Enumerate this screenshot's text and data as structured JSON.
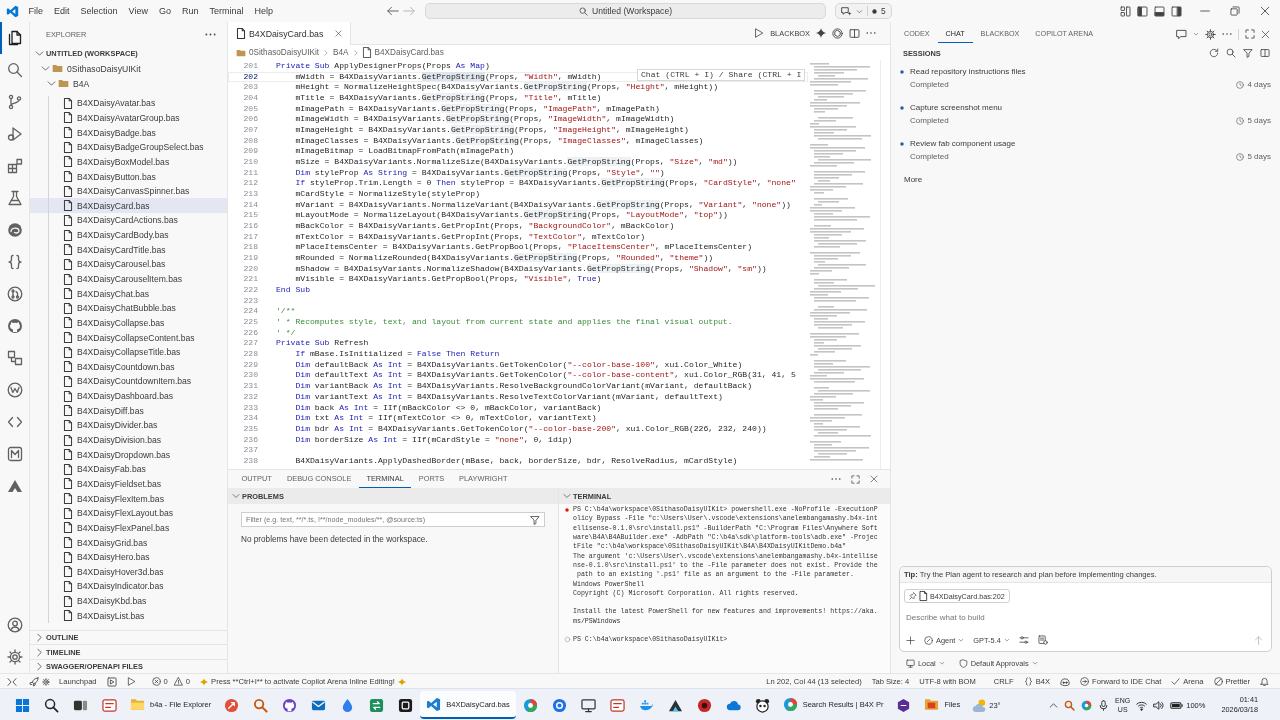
{
  "title_bar": {
    "menu": [
      "File",
      "Edit",
      "Selection",
      "View",
      "Go",
      "Run",
      "Terminal",
      "Help"
    ],
    "command_center": "Untitled (Workspace)",
    "badge": "5"
  },
  "activity_bar": [
    {
      "kind": "files",
      "selected": true
    },
    {
      "kind": "search",
      "selected": false
    },
    {
      "kind": "branch",
      "selected": false
    },
    {
      "kind": "debug",
      "selected": false
    },
    {
      "kind": "blocks",
      "selected": false
    },
    {
      "kind": "flask",
      "selected": false
    },
    {
      "kind": "browser",
      "selected": false
    },
    {
      "kind": "braces",
      "selected": false
    },
    {
      "kind": "pullrequest",
      "selected": false
    },
    {
      "kind": "cat",
      "selected": false
    },
    {
      "kind": "remote",
      "selected": false
    },
    {
      "kind": "wcircle",
      "selected": false
    },
    {
      "kind": "code",
      "selected": false
    },
    {
      "kind": "msquare",
      "selected": false
    },
    {
      "kind": "peak",
      "selected": false
    }
  ],
  "sidebar": {
    "title": "EXPLORER",
    "workspace": {
      "label": "UNTITLED (WORKSPACE)",
      "expanded": true
    },
    "tree": [
      {
        "label": "0SithasoDaisyUIKit",
        "expanded": true,
        "children": [
          {
            "label": "B4A",
            "expanded": true,
            "children": [
              {
                "label": "B4XDaisyAvatar.bas",
                "selected": false
              },
              {
                "label": "B4XDaisyAvatarGroup.bas",
                "selected": false
              },
              {
                "label": "B4XDaisyBadge.bas",
                "selected": false
              },
              {
                "label": "B4XDaisyBadgeGroupSelect.bas",
                "selected": false
              },
              {
                "label": "B4XDaisyBoxModel.bas",
                "selected": false
              },
              {
                "label": "B4XDaisyButton.bas",
                "selected": false
              },
              {
                "label": "B4XDaisyCanvasSpinner.bas",
                "selected": false
              },
              {
                "label": "B4XDaisyCard.bas",
                "selected": true
              },
              {
                "label": "B4XDaisyCardActions.bas",
                "selected": false
              },
              {
                "label": "B4XDaisyCardBody.bas",
                "selected": false
              },
              {
                "label": "B4XDaisyCardTitle.bas",
                "selected": false
              },
              {
                "label": "B4XDaisyCarousel.bas",
                "selected": false
              },
              {
                "label": "B4XDaisyCarouselItem.bas",
                "selected": false
              },
              {
                "label": "B4XDaisyChat.bas",
                "selected": false
              },
              {
                "label": "B4XDaisyChatBubble.bas",
                "selected": false
              },
              {
                "label": "B4XDaisyCollapse.bas",
                "selected": false
              },
              {
                "label": "B4XDaisyCollapseContent.bas",
                "selected": false
              },
              {
                "label": "B4XDaisyCollapseTitle.bas",
                "selected": false
              },
              {
                "label": "B4XDaisyCountdown.bas",
                "selected": false
              },
              {
                "label": "B4XDaisyCountdownItem.bas",
                "selected": false
              },
              {
                "label": "B4XDaisyDashboard.bas",
                "selected": false
              },
              {
                "label": "B4XDaisyDiff.bas",
                "selected": false
              },
              {
                "label": "B4XDaisyDivider.bas",
                "selected": false
              },
              {
                "label": "B4XDaisyDivision.bas",
                "selected": false
              },
              {
                "label": "B4XDaisyDropdown.bas",
                "selected": false
              },
              {
                "label": "B4XDaisyFab.bas",
                "selected": false
              },
              {
                "label": "B4XDaisyFieldset.bas",
                "selected": false
              },
              {
                "label": "B4XDaisyFlexItem.bas",
                "selected": false
              },
              {
                "label": "B4XDaisyFlexLayout.bas",
                "selected": false
              },
              {
                "label": "B4XDaisyFlexPanel.bas",
                "selected": false
              },
              {
                "label": "B4XDaisyGrid.bas",
                "selected": false
              },
              {
                "label": "B4XDaisyHero.bas",
                "selected": false
              },
              {
                "label": "B4XDaisyHover3d.bas",
                "selected": false
              },
              {
                "label": "B4XDaisyIndicator.bas",
                "selected": false
              },
              {
                "label": "B4XDaisyKbd.bas",
                "selected": false
              },
              {
                "label": "B4XDaisyList.bas",
                "selected": false
              }
            ]
          }
        ]
      }
    ],
    "sections": [
      {
        "label": "OUTLINE",
        "expanded": false
      },
      {
        "label": "TIMELINE",
        "expanded": false
      },
      {
        "label": "SWAGGER/OPENAPI FILES",
        "expanded": false
      }
    ]
  },
  "editor": {
    "tabs": [
      {
        "label": "B4XDaisyCard.bas",
        "selected": true
      }
    ],
    "toolbar_label": "BLACKBOX",
    "breadcrumb": [
      "0SithasoDaisyUIKit",
      "B4A",
      "B4XDaisyCard.bas"
    ],
    "hint": "Chat (CTRL + I) / Share (CTRL + I",
    "lines": [
      {
        "number": "201",
        "current": false,
        "tokens": [
          {
            "kind": "keyword",
            "text": "Private Sub"
          },
          " ApplyDesignerProps(Props ",
          {
            "kind": "keyword",
            "text": "As Map"
          },
          ")"
        ]
      },
      {
        "number": "202",
        "current": true,
        "tokens": [
          "    mWidth = B4XDaisyVariants.",
          {
            "kind": "selection",
            "text": "GetPropString"
          },
          "(Props, ",
          {
            "kind": "string",
            "text": "\"Width\""
          },
          ", mWidth)"
        ]
      },
      {
        "number": "203",
        "current": false,
        "tokens": [
          "    mHeight = NormalizeHeightSpec(B4XDaisyVariants.",
          {
            "kind": "match",
            "text": "GetPropString"
          },
          "(Props, ",
          {
            "kind": "string",
            "text": "\"Height\""
          },
          ", mHeight))"
        ]
      },
      {
        "number": "204",
        "current": false,
        "tokens": [
          "    mTitle = B4XDaisyVariants.",
          {
            "kind": "match",
            "text": "GetPropString"
          },
          "(Props, ",
          {
            "kind": "string",
            "text": "\"Title\""
          },
          ", mTitle)"
        ]
      },
      {
        "number": "205",
        "current": false,
        "tokens": [
          "    mImagePath = B4XDaisyVariants.",
          {
            "kind": "match",
            "text": "GetPropString"
          },
          "(Props, ",
          {
            "kind": "string",
            "text": "\"ImagePath\""
          },
          ", mImagePath)"
        ]
      },
      {
        "number": "206",
        "current": false,
        "tokens": [
          "    mImageWidth = B4XDaisyVariants.",
          {
            "kind": "match",
            "text": "GetPropString"
          },
          "(Props, ",
          {
            "kind": "string",
            "text": "\"ImageWidth\""
          },
          ", mImageWidth)"
        ]
      },
      {
        "number": "207",
        "current": false,
        "tokens": [
          "    mImageHeight = B4XDaisyVariants.",
          {
            "kind": "match",
            "text": "GetPropString"
          },
          "(Props, ",
          {
            "kind": "string",
            "text": "\"ImageHeight\""
          },
          ", mImageHeight)"
        ]
      },
      {
        "number": "208",
        "current": false,
        "tokens": [
          "    mImageClasses = B4XDaisyVariants.",
          {
            "kind": "match",
            "text": "GetPropString"
          },
          "(Props, ",
          {
            "kind": "string",
            "text": "\"ImageClasses\""
          },
          ", mImageClasses)"
        ]
      },
      {
        "number": "209",
        "current": false,
        "tokens": [
          "    mImageBitmap = LoadBitmapFromPath(mImagePath)"
        ]
      },
      {
        "number": "210",
        "current": false,
        "tokens": [
          "    mSize = B4XDaisyVariants.NormalizeSize(B4XDaisyVariants.",
          {
            "kind": "match",
            "text": "GetPropString"
          },
          "(Props, ",
          {
            "kind": "string",
            "text": "\"Size\""
          },
          ", ",
          {
            "kind": "string",
            "text": "\"md\""
          },
          "))"
        ]
      },
      {
        "number": "211",
        "current": false,
        "tokens": [
          {
            "kind": "keyword",
            "text": "    Dim"
          },
          " styleProp ",
          {
            "kind": "keyword",
            "text": "As String"
          },
          " = B4XDaisyVariants.",
          {
            "kind": "match",
            "text": "GetPropString"
          },
          "(Props, ",
          {
            "kind": "string",
            "text": "\"Style\""
          },
          ", ",
          {
            "kind": "string",
            "text": "\"\""
          },
          ")"
        ]
      },
      {
        "number": "212",
        "current": false,
        "tokens": [
          {
            "kind": "keyword",
            "text": "    If"
          },
          " styleProp.Trim.Length = 0 ",
          {
            "kind": "keyword",
            "text": "Then"
          },
          " styleProp = B4XDaisyVariants.",
          {
            "kind": "match",
            "text": "GetPropString"
          },
          "(Props, ",
          {
            "kind": "string",
            "text": "\"CardStyle\""
          },
          ", ",
          {
            "kind": "string",
            "text": "\"none\""
          }
        ]
      },
      {
        "number": "213",
        "current": false,
        "tokens": [
          "    mCardStyle = NormalizeStyle(styleProp)"
        ]
      },
      {
        "number": "214",
        "current": false,
        "tokens": [
          "    mVariant = B4XDaisyVariants.NormalizeVariant(B4XDaisyVariants.",
          {
            "kind": "match",
            "text": "GetPropString"
          },
          "(Props, ",
          {
            "kind": "string",
            "text": "\"Variant\""
          },
          ", ",
          {
            "kind": "string",
            "text": "\"none\""
          },
          "))"
        ]
      },
      {
        "number": "215",
        "current": false,
        "tokens": [
          "    mLayoutMode = NormalizeLayout(B4XDaisyVariants.",
          {
            "kind": "match",
            "text": "GetPropString"
          },
          "(Props, ",
          {
            "kind": "string",
            "text": "\"LayoutMode\""
          },
          ", ",
          {
            "kind": "string",
            "text": "\"top\""
          },
          "))"
        ]
      },
      {
        "number": "216",
        "current": false,
        "tokens": [
          "    mBackColor = B4XDaisyVariants.GetPropInt(Props, ",
          {
            "kind": "string",
            "text": "\"BackgroundColor\""
          },
          ", mBackColor)"
        ]
      },
      {
        "number": "217",
        "current": false,
        "tokens": [
          "    mTextColor = B4XDaisyVariants.GetPropInt(Props, ",
          {
            "kind": "string",
            "text": "\"TextColor\""
          },
          ", mTextColor)"
        ]
      },
      {
        "number": "218",
        "current": false,
        "tokens": [
          "    mPlaceItemsCenter = B4XDaisyVariants.GetPropBool(Props, ",
          {
            "kind": "string",
            "text": "\"PlaceItemsCenter\""
          },
          ", mPlaceItemsCenter)"
        ]
      },
      {
        "number": "219",
        "current": false,
        "tokens": [
          "    mRounded = NormalizeRounded(B4XDaisyVariants.",
          {
            "kind": "match",
            "text": "GetPropString"
          },
          "(Props, ",
          {
            "kind": "string",
            "text": "\"Rounded\""
          },
          ", ",
          {
            "kind": "string",
            "text": "\"theme\""
          },
          "))"
        ]
      },
      {
        "number": "220",
        "current": false,
        "tokens": [
          "    mShadow = B4XDaisyVariants.NormalizeShadow(B4XDaisyVariants.",
          {
            "kind": "match",
            "text": "GetPropString"
          },
          "(Props, ",
          {
            "kind": "string",
            "text": "\"Shadow\""
          },
          ", ",
          {
            "kind": "string",
            "text": "\"sm\""
          },
          "))"
        ]
      },
      {
        "number": "221",
        "current": false,
        "tokens": [
          "    mVisible = B4XDaisyVariants.GetPropBool(Props, ",
          {
            "kind": "string",
            "text": "\"Visible\""
          },
          ", ",
          {
            "kind": "keyword",
            "text": "True"
          },
          ")"
        ]
      },
      {
        "number": "222",
        "current": false,
        "tokens": [
          {
            "kind": "keyword",
            "text": "End Sub"
          }
        ]
      },
      {
        "number": "223",
        "current": false
      },
      {
        "number": "224",
        "current": false,
        "tokens": [
          {
            "kind": "comment",
            "text": "'/**"
          }
        ]
      },
      {
        "number": "225",
        "current": false,
        "tokens": [
          {
            "kind": "comment",
            "text": "' * Recomputes style, text, and layout from current state and applies the final visual output."
          }
        ]
      },
      {
        "number": "226",
        "current": false,
        "tokens": [
          {
            "kind": "comment",
            "text": "' */"
          }
        ]
      },
      {
        "number": "227",
        "current": false,
        "tokens": [
          {
            "kind": "keyword",
            "text": "Private Sub"
          },
          " Refresh"
        ]
      },
      {
        "number": "228",
        "current": false,
        "tokens": [
          {
            "kind": "keyword",
            "text": "    If"
          },
          " mBase.IsInitialized = ",
          {
            "kind": "keyword",
            "text": "False Then Return"
          }
        ]
      },
      {
        "number": "229",
        "current": false,
        "tokens": [
          {
            "kind": "keyword",
            "text": "    Dim"
          },
          " defaultBack ",
          {
            "kind": "keyword",
            "text": "As Int"
          },
          " = B4XDaisyVariants.GetTokenColor(",
          {
            "kind": "string",
            "text": "\"--color-base-100\""
          },
          ", xui.Color_White)"
        ]
      },
      {
        "number": "230",
        "current": false,
        "tokens": [
          {
            "kind": "keyword",
            "text": "    Dim"
          },
          " defaultText ",
          {
            "kind": "keyword",
            "text": "As Int"
          },
          " = B4XDaisyVariants.GetTokenColor(",
          {
            "kind": "string",
            "text": "\"--color-base-content\""
          },
          ", xui.Color_RGB(31, 41, 5"
        ]
      },
      {
        "number": "231",
        "current": false,
        "tokens": [
          {
            "kind": "keyword",
            "text": "    Dim"
          },
          " variantBack ",
          {
            "kind": "keyword",
            "text": "As Int"
          },
          " = B4XDaisyVariants.ResolveBackgroundColorVariant(mVariant, defaultBack)"
        ]
      },
      {
        "number": "232",
        "current": false,
        "tokens": [
          {
            "kind": "keyword",
            "text": "    Dim"
          },
          " variantText ",
          {
            "kind": "keyword",
            "text": "As Int"
          },
          " = B4XDaisyVariants.ResolveTextColorVariant(mVariant, defaultText)"
        ]
      },
      {
        "number": "233",
        "current": false,
        "tokens": [
          {
            "kind": "keyword",
            "text": "    Dim"
          },
          " back ",
          {
            "kind": "keyword",
            "text": "As Int"
          },
          " = IIf(mBackColor <> 0, mBackColor, variantBack)"
        ]
      },
      {
        "number": "234",
        "current": false,
        "tokens": [
          {
            "kind": "keyword",
            "text": "    Dim"
          },
          " txt ",
          {
            "kind": "keyword",
            "text": "As Int"
          },
          " = IIf(mTextColor <> 0, mTextColor, variantText)"
        ]
      },
      {
        "number": "235",
        "current": false,
        "tokens": [
          {
            "kind": "keyword",
            "text": "    Dim"
          },
          " bdr ",
          {
            "kind": "keyword",
            "text": "As Int"
          },
          " = B4XDaisyVariants.GetTokenColor(",
          {
            "kind": "string",
            "text": "\"--color-base-200\""
          },
          ", xui.Color_RGB(226, 232, 240))"
        ]
      },
      {
        "number": "236",
        "current": false,
        "tokens": [
          {
            "kind": "keyword",
            "text": "    Dim"
          },
          " borderSize ",
          {
            "kind": "keyword",
            "text": "As Int"
          },
          " = IIf(mCardStyle = ",
          {
            "kind": "string",
            "text": "\"none\""
          },
          ", 0, 1dip)"
        ]
      },
      {
        "number": "237",
        "current": false
      },
      {
        "number": "238",
        "current": false,
        "tokens": [
          "    B4XDaisyVariants.ApplyDashedBorder(mBase, back, borderSize, bdr, ResolveRadius, mCardStyle)"
        ]
      }
    ]
  },
  "panel": {
    "tabs": [
      {
        "label": "OUTPUT",
        "selected": false
      },
      {
        "label": "DEBUG CONSOLE",
        "selected": false
      },
      {
        "label": "TERMINAL",
        "selected": true
      },
      {
        "label": "PORTS",
        "selected": false
      },
      {
        "label": "PLAYWRIGHT",
        "selected": false
      }
    ],
    "problems": {
      "title": "PROBLEMS",
      "filter": {
        "placeholder": "Filter (e.g. text, **/*.ts, !**/node_modules/**, @source:ts)"
      },
      "message": "No problems have been detected in the workspace."
    },
    "terminal": {
      "title": "TERMINAL",
      "blocks": [
        [
          {
            "kind": "failed",
            "text": "PS C:\\b4a\\workspace\\0SithasoDaisyUIKit> powershell.exe -NoProfile -ExecutionP"
          },
          {
            "kind": "output",
            "text": "olicy Bypass -File \"c:\\Users\\User\\.vscode\\extensions\\anelembangamashy.b4x-int"
          },
          {
            "kind": "output",
            "text": "ellisense-0.1.0\\src\\install.ps1\" -BuilderPath \"C:\\Program Files\\Anywhere Soft"
          },
          {
            "kind": "output",
            "text": "ware\\B4A\\B4ABuilder.exe\" -AdbPath \"C:\\b4a\\sdk\\platform-tools\\adb.exe\" -Projec"
          },
          {
            "kind": "output",
            "text": "tFile \"c:\\b4a\\workspace\\0SithasoDaisyUIKit\\B4A\\B4XDaisyUIKitDemo.b4a\""
          },
          {
            "kind": "output",
            "text": "The argument 'c:\\Users\\User\\.vscode\\extensions\\anelembangamashy.b4x-intellise"
          },
          {
            "kind": "output",
            "text": "nse-0.1.0\\src\\install.ps1' to the -File parameter does not exist. Provide the"
          },
          {
            "kind": "output",
            "text": " path to an existing '.ps1' file as an argument to the -File parameter."
          },
          {
            "kind": "output",
            "text": "Windows PowerShell"
          },
          {
            "kind": "output",
            "text": "Copyright (C) Microsoft Corporation. All rights reserved."
          }
        ],
        [
          {
            "kind": "output",
            "text": "Install the latest PowerShell for new features and improvements! https://aka."
          },
          {
            "kind": "output",
            "text": "ms/PSWindows"
          }
        ],
        [
          {
            "kind": "prompt",
            "text": "PS C:\\b4a\\workspace\\0SithasoDaisyUIKit>"
          }
        ]
      ]
    }
  },
  "chat": {
    "tabs": [
      {
        "label": "CODEX",
        "selected": false
      },
      {
        "label": "CHAT",
        "selected": true
      },
      {
        "label": "BLACKBOX",
        "selected": false
      },
      {
        "label": "COPILOT ARENA",
        "selected": false
      }
    ],
    "sessions": {
      "title": "SESSIONS",
      "items": [
        {
          "title": "Read repository instructions files",
          "status": "Completed",
          "age": "4 days"
        },
        {
          "title": "Capture screenshot menu",
          "status": "Completed",
          "age": "5 days"
        },
        {
          "title": "Review fab component usage",
          "status": "Completed",
          "age": "5 days"
        }
      ],
      "more": "More"
    },
    "composer": {
      "tip": "**Tip:** Try the Plan agent to research and plan before implementing changes.",
      "attachment": "B4XDaisyCard.bas:202",
      "placeholder": "Describe what to build",
      "mode": "Agent",
      "model": "GPT-5.4"
    },
    "footer": {
      "location": "Local",
      "approvals": "Default Approvals"
    }
  },
  "status_bar": {
    "launchpad": "Launchpad",
    "errors": "0",
    "warnings": "0",
    "message": "Press **Ctrl+I** to activate Copilot Arena Inline Editing!",
    "position": "Ln 202, Col 44 (13 selected)",
    "tab_size": "Tab Size: 4",
    "encoding": "UTF-8 with BOM",
    "line_ending": "CRLF",
    "language": "B4X",
    "forward": "Forward to IDE Chat",
    "arena": "Arena",
    "formatter": "Prettier"
  },
  "taskbar": {
    "apps": [
      {
        "label": "b4a - File Explorer",
        "selected": false
      },
      {
        "label": "B4XDaisyCard.bas",
        "selected": true
      },
      {
        "label": "Search Results | B4X Pr",
        "selected": false
      },
      {
        "label": "Files",
        "selected": false
      }
    ],
    "weather": "23°",
    "language": "ENG",
    "region": "US",
    "battery": "100%",
    "time": "01:41",
    "date": "2026/03/18"
  }
}
